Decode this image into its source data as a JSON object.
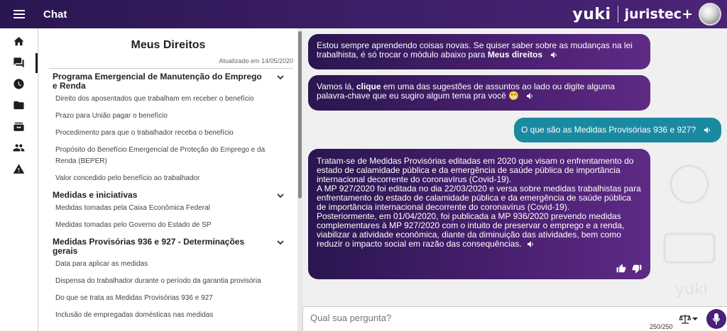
{
  "header": {
    "title": "Chat",
    "brand_left": "yuki",
    "brand_right": "juristec+",
    "bg_colors": [
      "#2a1650",
      "#4b2478"
    ]
  },
  "rail": {
    "items": [
      {
        "icon": "home-icon"
      },
      {
        "icon": "chat-icon",
        "active": true
      },
      {
        "icon": "clock-icon"
      },
      {
        "icon": "folder-icon"
      },
      {
        "icon": "inbox-icon"
      },
      {
        "icon": "people-icon"
      },
      {
        "icon": "warning-icon"
      }
    ]
  },
  "panel": {
    "title": "Meus Direitos",
    "updated": "Atualizado em 14/05/2020",
    "sections": [
      {
        "title": "Programa Emergencial de Manutenção do Emprego e Renda",
        "items": [
          "Direito dos aposentados que trabalham em receber o benefício",
          "Prazo para União pagar o benefício",
          "Procedimento para que o trabalhador receba o benefício",
          "Propósito do Benefício Emergencial de Proteção do Emprego e da Renda (BEPER)",
          "Valor concedido pelo benefício ao trabalhador"
        ]
      },
      {
        "title": "Medidas e iniciativas",
        "items": [
          "Medidas tomadas pela Caixa Econômica Federal",
          "Medidas tomadas pelo Governo do Estado de SP"
        ]
      },
      {
        "title": "Medidas Provisórias 936 e 927 - Determinações gerais",
        "items": [
          "Data para aplicar as medidas",
          "Dispensa do trabalhador durante o período da garantia provisória",
          "Do que se trata as Medidas Provisórias 936 e 927",
          "Inclusão de empregadas domésticas nas medidas"
        ]
      }
    ]
  },
  "chat": {
    "messages": [
      {
        "from": "bot",
        "pre": "Estou sempre aprendendo coisas novas. Se quiser saber sobre as mudanças na lei trabalhista, é só trocar o módulo abaixo para ",
        "bold": "Meus direitos",
        "post": ""
      },
      {
        "from": "bot",
        "pre": "Vamos lá, ",
        "bold": "clique",
        "post": " em uma das sugestões de assuntos ao lado ou digite alguma palavra-chave que eu sugiro algum tema pra você 😁"
      },
      {
        "from": "user",
        "text": "O que são as Medidas Provisórias 936 e 927?"
      },
      {
        "from": "bot",
        "lines": [
          "Tratam-se de Medidas Provisórias editadas em 2020 que visam o enfrentamento do estado de calamidade pública e da emergência de saúde pública de importância internacional decorrente do coronavírus (Covid-19).",
          "A MP 927/2020 foi editada no dia 22/03/2020 e versa sobre medidas trabalhistas para enfrentamento do estado de calamidade pública e da emergência de saúde pública de importância internacional decorrente do coronavírus (Covid-19).",
          "Posteriormente, em 01/04/2020, foi publicada a MP 936/2020 prevendo medidas complementares à MP 927/2020 com o intuito de preservar o emprego e a renda, viabilizar a atividade econômica, diante da diminuição das atividades, bem como reduzir o impacto social em razão das consequências."
        ]
      }
    ],
    "bot_color": "#4a2070",
    "user_color": "#1b8aa0"
  },
  "input": {
    "placeholder": "Qual sua pergunta?",
    "counter": "250/250"
  }
}
